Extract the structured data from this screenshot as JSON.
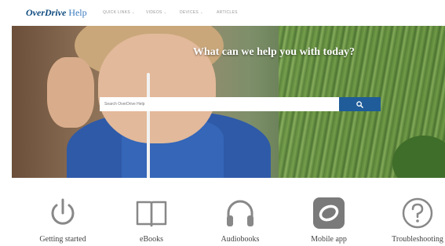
{
  "header": {
    "brand": "OverDrive",
    "help_label": "Help",
    "nav": [
      {
        "label": "QUICK LINKS",
        "has_dropdown": true
      },
      {
        "label": "VIDEOS",
        "has_dropdown": true
      },
      {
        "label": "DEVICES",
        "has_dropdown": true
      },
      {
        "label": "ARTICLES",
        "has_dropdown": false
      }
    ]
  },
  "hero": {
    "headline": "What can we help you with today?",
    "search_placeholder": "Search OverDrive Help",
    "search_icon": "search-icon"
  },
  "categories": [
    {
      "label": "Getting started",
      "icon": "power-icon"
    },
    {
      "label": "eBooks",
      "icon": "book-icon"
    },
    {
      "label": "Audiobooks",
      "icon": "headphones-icon"
    },
    {
      "label": "Mobile app",
      "icon": "mobile-app-icon"
    },
    {
      "label": "Troubleshooting",
      "icon": "question-icon"
    }
  ],
  "colors": {
    "brand_blue": "#1f5c99",
    "icon_gray": "#888888"
  }
}
